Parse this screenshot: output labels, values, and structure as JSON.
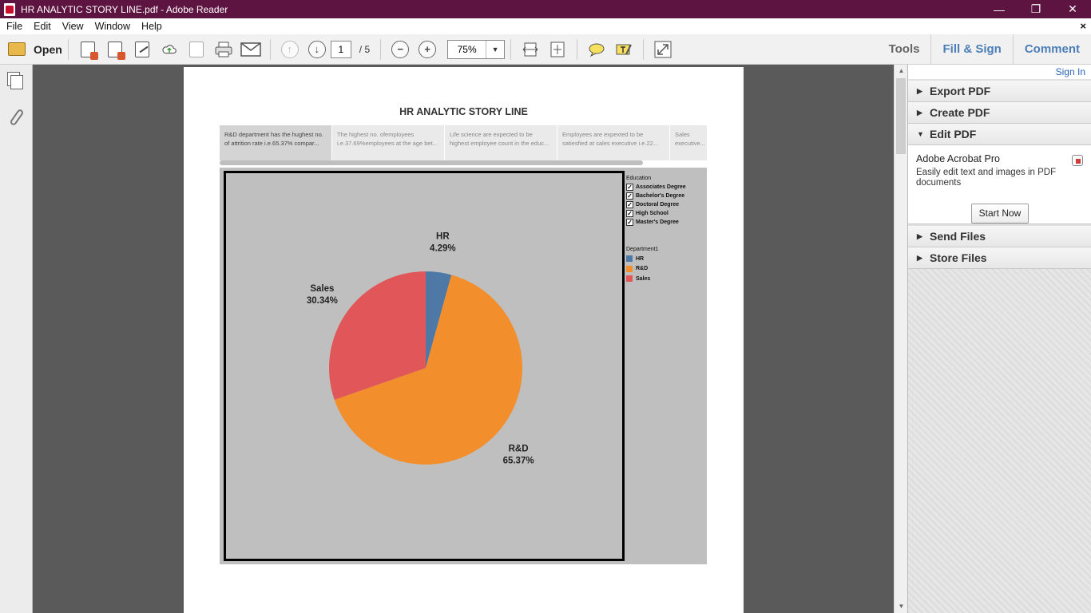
{
  "window": {
    "title": "HR ANALYTIC STORY LINE.pdf - Adobe Reader",
    "minimize": "—",
    "restore": "❐",
    "close": "✕"
  },
  "menu": {
    "items": [
      "File",
      "Edit",
      "View",
      "Window",
      "Help"
    ],
    "close_doc": "×"
  },
  "toolbar": {
    "open_label": "Open",
    "page_current": "1",
    "page_total": "/ 5",
    "zoom": "75%",
    "zoom_arrow": "▼",
    "tools_label": "Tools",
    "fill_sign_label": "Fill & Sign",
    "comment_label": "Comment",
    "prev_page_glyph": "↑",
    "next_page_glyph": "↓",
    "zoom_out_glyph": "−",
    "zoom_in_glyph": "+"
  },
  "document": {
    "title": "HR ANALYTIC STORY LINE",
    "story_points": [
      "R&D department has the hughest no. of attrition rate  i.e.65.37% compar...",
      "The highest no. ofemployees i.e.37.69%employees at the age bet...",
      "Life science are expected to be highest employee count in the educ...",
      "Employees are expexted to be satiesfied at  sales executive  i.e.22...",
      "Sales executive..."
    ],
    "legend_education": {
      "title": "Education",
      "items": [
        "Associates Degree",
        "Bachelor's Degree",
        "Doctoral Degree",
        "High School",
        "Master's Degree"
      ],
      "check": "✓"
    },
    "legend_department": {
      "title": "Department1",
      "items": [
        {
          "name": "HR",
          "color": "#4e79a7"
        },
        {
          "name": "R&D",
          "color": "#f28e2b"
        },
        {
          "name": "Sales",
          "color": "#e15759"
        }
      ]
    }
  },
  "chart_data": {
    "type": "pie",
    "slices": [
      {
        "label": "HR",
        "value": 4.29,
        "display": "4.29%",
        "color": "#4e79a7"
      },
      {
        "label": "R&D",
        "value": 65.37,
        "display": "65.37%",
        "color": "#f28e2b"
      },
      {
        "label": "Sales",
        "value": 30.34,
        "display": "30.34%",
        "color": "#e15759"
      }
    ]
  },
  "right_pane": {
    "sign_in": "Sign In",
    "panels": [
      {
        "label": "Export PDF",
        "tri": "▶"
      },
      {
        "label": "Create PDF",
        "tri": "▶"
      },
      {
        "label": "Edit PDF",
        "tri": "▼"
      }
    ],
    "promo": {
      "product": "Adobe Acrobat Pro",
      "description": "Easily edit text and images in PDF documents",
      "button": "Start Now"
    },
    "panels_after": [
      {
        "label": "Send Files",
        "tri": "▶"
      },
      {
        "label": "Store Files",
        "tri": "▶"
      }
    ]
  },
  "scrollbar": {
    "up": "▲",
    "down": "▼"
  }
}
